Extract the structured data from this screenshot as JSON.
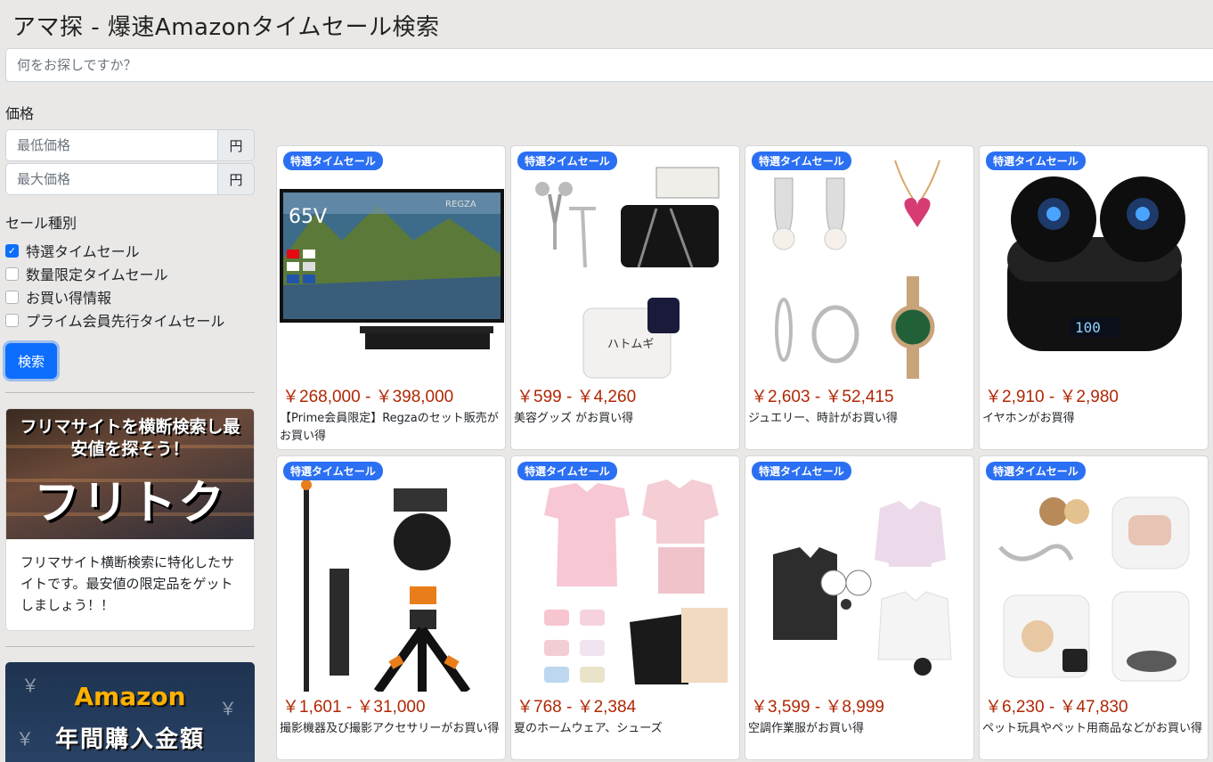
{
  "site": {
    "title": "アマ探 - 爆速Amazonタイムセール検索"
  },
  "search": {
    "placeholder": "何をお探しですか？"
  },
  "filters": {
    "price_label": "価格",
    "min_placeholder": "最低価格",
    "max_placeholder": "最大価格",
    "currency_unit": "円",
    "sale_type_label": "セール種別",
    "options": [
      {
        "label": "特選タイムセール",
        "checked": true
      },
      {
        "label": "数量限定タイムセール",
        "checked": false
      },
      {
        "label": "お買い得情報",
        "checked": false
      },
      {
        "label": "プライム会員先行タイムセール",
        "checked": false
      }
    ],
    "search_button": "検索"
  },
  "banners": {
    "furitoku": {
      "headline": "フリマサイトを横断検索し最安値を探そう！",
      "logo_text": "フリトク",
      "description": "フリマサイト横断検索に特化したサイトです。最安値の限定品をゲットしましょう！！"
    },
    "amazon_spend": {
      "title": "Amazon",
      "subtitle": "年間購入金額"
    }
  },
  "products": [
    {
      "badge": "特選タイムセール",
      "price": "￥268,000 - ￥398,000",
      "description": "【Prime会員限定】Regzaのセット販売がお買い得",
      "image": "tv"
    },
    {
      "badge": "特選タイムセール",
      "price": "￥599 - ￥4,260",
      "description": "美容グッズ がお買い得",
      "image": "beauty"
    },
    {
      "badge": "特選タイムセール",
      "price": "￥2,603 - ￥52,415",
      "description": "ジュエリー、時計がお買い得",
      "image": "jewelry"
    },
    {
      "badge": "特選タイムセール",
      "price": "￥2,910 - ￥2,980",
      "description": "イヤホンがお買得",
      "image": "earbuds"
    },
    {
      "badge": "特選タイムセール",
      "price": "￥1,601 - ￥31,000",
      "description": "撮影機器及び撮影アクセサリーがお買い得",
      "image": "tripod"
    },
    {
      "badge": "特選タイムセール",
      "price": "￥768 - ￥2,384",
      "description": "夏のホームウェア、シューズ",
      "image": "homewear"
    },
    {
      "badge": "特選タイムセール",
      "price": "￥3,599 - ￥8,999",
      "description": "空調作業服がお買い得",
      "image": "fanwear"
    },
    {
      "badge": "特選タイムセール",
      "price": "￥6,230 - ￥47,830",
      "description": "ペット玩具やペット用商品などがお買い得",
      "image": "pet"
    }
  ]
}
